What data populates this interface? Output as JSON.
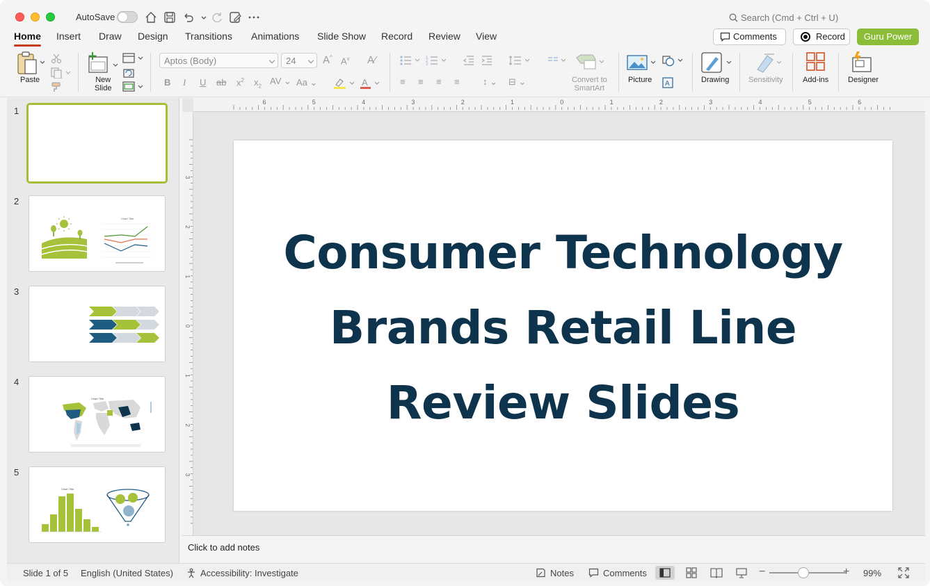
{
  "titlebar": {
    "autosave_label": "AutoSave",
    "search_placeholder": "Search (Cmd + Ctrl + U)"
  },
  "tabs": [
    "Home",
    "Insert",
    "Draw",
    "Design",
    "Transitions",
    "Animations",
    "Slide Show",
    "Record",
    "Review",
    "View"
  ],
  "actions": {
    "comments": "Comments",
    "record": "Record",
    "guru": "Guru Power"
  },
  "ribbon": {
    "paste": "Paste",
    "new_slide_1": "New",
    "new_slide_2": "Slide",
    "font_name": "Aptos (Body)",
    "font_size": "24",
    "convert_1": "Convert to",
    "convert_2": "SmartArt",
    "picture": "Picture",
    "drawing": "Drawing",
    "sensitivity": "Sensitivity",
    "addins": "Add-ins",
    "designer": "Designer"
  },
  "thumbnails": {
    "numbers": [
      "1",
      "2",
      "3",
      "4",
      "5"
    ],
    "chart_title": "Chart Title"
  },
  "ruler": {
    "h_ticks": [
      "6",
      "5",
      "4",
      "3",
      "2",
      "1",
      "0",
      "1",
      "2",
      "3",
      "4",
      "5",
      "6"
    ],
    "v_ticks": [
      "3",
      "2",
      "1",
      "0",
      "1",
      "2",
      "3"
    ]
  },
  "slide": {
    "title_line1": "Consumer Technology",
    "title_line2": "Brands Retail Line",
    "title_line3": "Review Slides"
  },
  "notes": {
    "placeholder": "Click to add notes"
  },
  "status": {
    "slide_counter": "Slide 1 of 5",
    "language": "English (United States)",
    "accessibility": "Accessibility: Investigate",
    "notes": "Notes",
    "comments": "Comments",
    "zoom": "99%"
  },
  "colors": {
    "accent_green": "#8cbd38",
    "title_navy": "#0d344c",
    "tab_underline": "#c43e1c",
    "navy_chevron": "#1f5c82"
  }
}
